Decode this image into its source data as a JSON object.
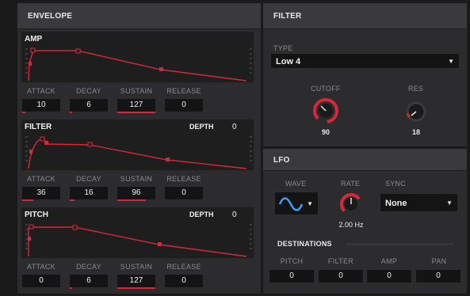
{
  "envelope": {
    "title": "ENVELOPE",
    "param_labels": [
      "ATTACK",
      "DECAY",
      "SUSTAIN",
      "RELEASE"
    ],
    "amp": {
      "name": "AMP",
      "attack": "10",
      "decay": "6",
      "sustain": "127",
      "release": "0"
    },
    "filter": {
      "name": "FILTER",
      "depth_label": "DEPTH",
      "depth": "0",
      "attack": "36",
      "decay": "16",
      "sustain": "96",
      "release": "0"
    },
    "pitch": {
      "name": "PITCH",
      "depth_label": "DEPTH",
      "depth": "0",
      "attack": "0",
      "decay": "6",
      "sustain": "127",
      "release": "0"
    }
  },
  "filter_panel": {
    "title": "FILTER",
    "type_label": "TYPE",
    "type_value": "Low 4",
    "cutoff_label": "CUTOFF",
    "cutoff_value": "90",
    "res_label": "RES",
    "res_value": "18"
  },
  "lfo": {
    "title": "LFO",
    "wave_label": "WAVE",
    "rate_label": "RATE",
    "rate_value": "2.00 Hz",
    "sync_label": "SYNC",
    "sync_value": "None",
    "destinations_label": "DESTINATIONS",
    "dest_labels": [
      "PITCH",
      "FILTER",
      "AMP",
      "PAN"
    ],
    "dest_values": [
      "0",
      "0",
      "0",
      "0"
    ]
  },
  "colors": {
    "accent": "#d6283b",
    "panel": "#2c2c2e",
    "header": "#3a3a3c",
    "field": "#141415",
    "graph_bg": "#1e1e1f"
  },
  "icons": {
    "wave": "sine-wave-icon",
    "dropdown": "triangle-down-icon"
  }
}
